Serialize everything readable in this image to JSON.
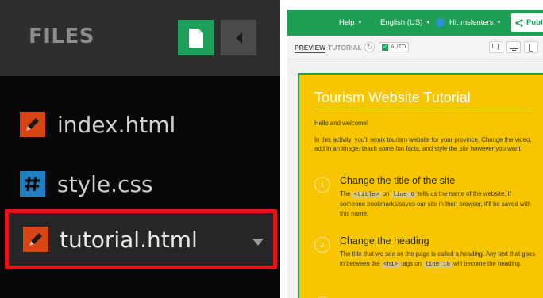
{
  "files_panel": {
    "title": "FILES",
    "new_file_icon": "document-icon",
    "collapse_icon": "triangle-left-icon",
    "files": [
      {
        "name": "index.html",
        "icon": "pencil-icon",
        "icon_color": "#d84515"
      },
      {
        "name": "style.css",
        "icon": "hash-icon",
        "icon_color": "#1f7fc2"
      },
      {
        "name": "tutorial.html",
        "icon": "pencil-icon",
        "icon_color": "#d84515",
        "active": true
      }
    ],
    "highlight_color": "#e5141b"
  },
  "topbar": {
    "help_label": "Help",
    "language_label": "English (US)",
    "user_label": "Hi, mslenters",
    "publish_label": "Publis",
    "brand_color": "#1e9f55"
  },
  "preview_toolbar": {
    "preview_tab": "PREVIEW",
    "tutorial_tab": "TUTORIAL",
    "auto_label": "AUTO",
    "auto_checked": "✓"
  },
  "tutorial": {
    "title": "Tourism Website Tutorial",
    "intro": "Hello and welcome!",
    "description": "In this activity, you'll remix tourism website for your province. Change the video, add in an image, teach some fun facts, and style the site however you want.",
    "steps": [
      {
        "number": "1",
        "title": "Change the title of the site",
        "text_a": "The",
        "code_a": "<title>",
        "text_b": "on",
        "code_b": "line 6",
        "text_c": "tells us the name of the website. If someone bookmarks/saves our site in their browser, it'll be saved with this name."
      },
      {
        "number": "2",
        "title": "Change the heading",
        "text_a": "The title that we see on the page is called a heading. Any text that goes in between the",
        "code_a": "<h1>",
        "text_b": "tags on",
        "code_b": "line 10",
        "text_c": "will become the heading."
      }
    ],
    "accent_color": "#f7c600"
  }
}
